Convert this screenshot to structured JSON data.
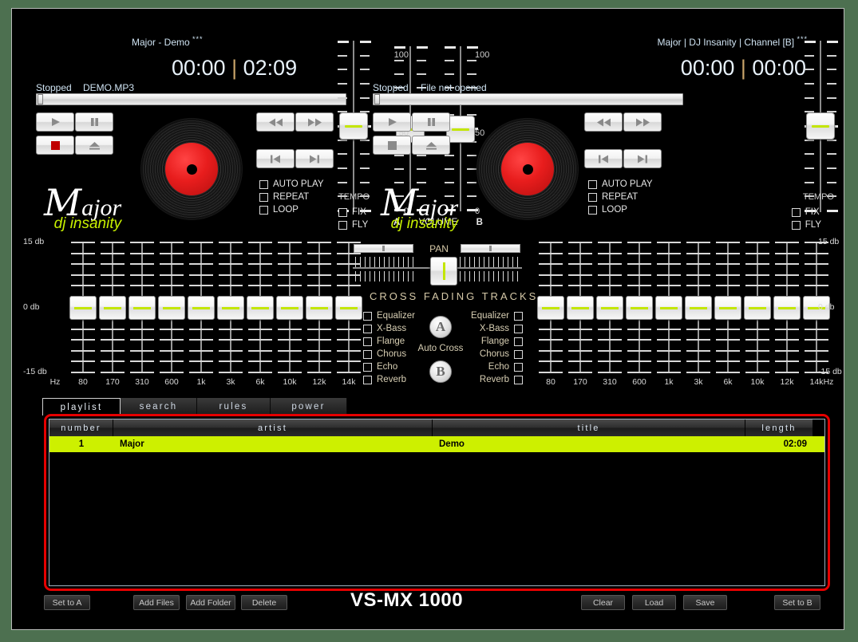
{
  "app": {
    "brand_main": "ajor",
    "brand_cap": "M",
    "brand_sub": "dj insanity",
    "model": "VS-MX 1000",
    "accent_red": "#e50000",
    "accent_green": "#c3e600",
    "highlight_row": "#cdf000"
  },
  "deck_a": {
    "track_title": "Major  -  Demo",
    "stars": "***",
    "elapsed": "00:00",
    "separator": "|",
    "total": "02:09",
    "state": "Stopped",
    "file": "DEMO.MP3",
    "options": [
      {
        "label": "AUTO PLAY",
        "checked": false
      },
      {
        "label": "REPEAT",
        "checked": false
      },
      {
        "label": "LOOP",
        "checked": false
      }
    ],
    "tempo": {
      "label": "TEMPO",
      "fix": "FIX",
      "fly": "FLY",
      "fix_checked": false,
      "fly_checked": false
    },
    "transport": [
      {
        "name": "play",
        "icon": "play-icon"
      },
      {
        "name": "pause",
        "icon": "pause-icon"
      },
      {
        "name": "stop",
        "icon": "stop-icon"
      },
      {
        "name": "eject",
        "icon": "eject-icon"
      },
      {
        "name": "rewind",
        "icon": "rewind-icon"
      },
      {
        "name": "fast-forward",
        "icon": "fast-forward-icon"
      },
      {
        "name": "previous",
        "icon": "skip-back-icon"
      },
      {
        "name": "next",
        "icon": "skip-forward-icon"
      }
    ]
  },
  "deck_b": {
    "track_title": "Major | DJ Insanity | Channel [B]",
    "stars": "***",
    "elapsed": "00:00",
    "separator": "|",
    "total": "00:00",
    "state": "Stopped",
    "file": "File not opened",
    "options": [
      {
        "label": "AUTO PLAY",
        "checked": false
      },
      {
        "label": "REPEAT",
        "checked": false
      },
      {
        "label": "LOOP",
        "checked": false
      }
    ],
    "tempo": {
      "label": "TEMPO",
      "fix": "FIX",
      "fly": "FLY",
      "fix_checked": false,
      "fly_checked": false
    }
  },
  "volume": {
    "label": "VOLUME",
    "channel_a": "A",
    "channel_b": "B",
    "scale_top": "100",
    "scale_mid": "50",
    "scale_bottom": "0",
    "value_a": 50,
    "value_b": 50
  },
  "pan": {
    "label": "PAN",
    "value_a": 50,
    "value_b": 50
  },
  "crossfader": {
    "label": "CROSS FADING TRACKS",
    "value": 50
  },
  "auto_cross": {
    "label": "Auto Cross",
    "button_a": "A",
    "button_b": "B"
  },
  "effects_a": [
    {
      "label": "Equalizer",
      "checked": false
    },
    {
      "label": "X-Bass",
      "checked": false
    },
    {
      "label": "Flange",
      "checked": false
    },
    {
      "label": "Chorus",
      "checked": false
    },
    {
      "label": "Echo",
      "checked": false
    },
    {
      "label": "Reverb",
      "checked": false
    }
  ],
  "effects_b": [
    {
      "label": "Equalizer",
      "checked": false
    },
    {
      "label": "X-Bass",
      "checked": false
    },
    {
      "label": "Flange",
      "checked": false
    },
    {
      "label": "Chorus",
      "checked": false
    },
    {
      "label": "Echo",
      "checked": false
    },
    {
      "label": "Reverb",
      "checked": false
    }
  ],
  "equalizer": {
    "unit_label": "Hz",
    "scale_top": "15 db",
    "scale_mid": "0 db",
    "scale_bottom": "-15 db",
    "bands": [
      "80",
      "170",
      "310",
      "600",
      "1k",
      "3k",
      "6k",
      "10k",
      "12k",
      "14k"
    ],
    "values_a": [
      0,
      0,
      0,
      0,
      0,
      0,
      0,
      0,
      0,
      0
    ],
    "values_b": [
      0,
      0,
      0,
      0,
      0,
      0,
      0,
      0,
      0,
      0
    ]
  },
  "tabs": [
    {
      "label": "playlist",
      "active": true
    },
    {
      "label": "search",
      "active": false
    },
    {
      "label": "rules",
      "active": false
    },
    {
      "label": "power",
      "active": false
    }
  ],
  "playlist": {
    "columns": [
      "number",
      "artist",
      "title",
      "length"
    ],
    "rows": [
      {
        "number": "1",
        "artist": "Major",
        "title": "Demo",
        "length": "02:09",
        "selected": true
      }
    ]
  },
  "footer": {
    "left_buttons": [
      {
        "label": "Set to A",
        "name": "set-to-a-button"
      },
      {
        "label": "Add Files",
        "name": "add-files-button"
      },
      {
        "label": "Add Folder",
        "name": "add-folder-button"
      },
      {
        "label": "Delete",
        "name": "delete-button"
      }
    ],
    "right_buttons": [
      {
        "label": "Clear",
        "name": "clear-button"
      },
      {
        "label": "Load",
        "name": "load-button"
      },
      {
        "label": "Save",
        "name": "save-button"
      },
      {
        "label": "Set to B",
        "name": "set-to-b-button"
      }
    ]
  }
}
